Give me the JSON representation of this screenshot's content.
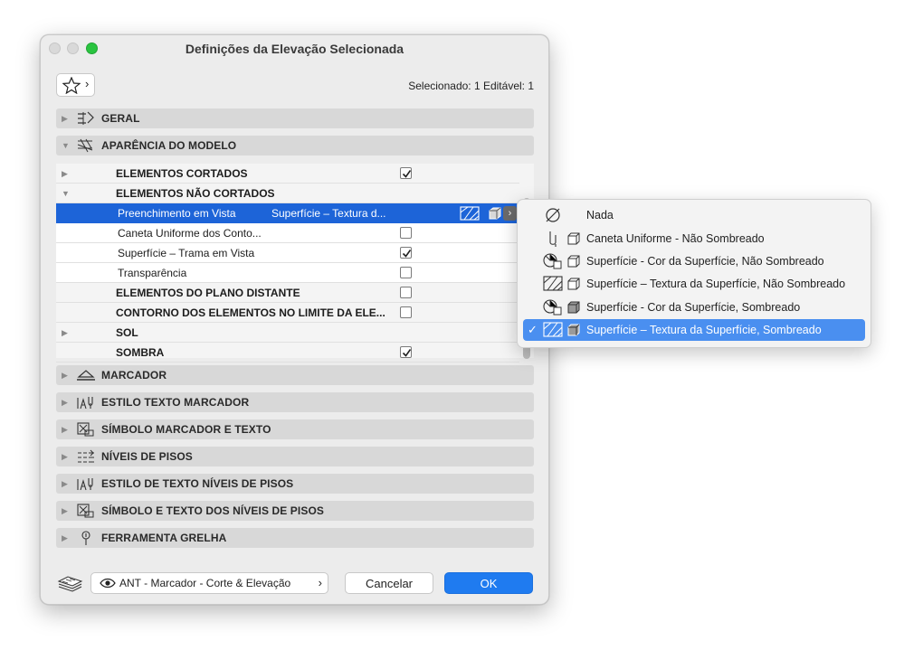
{
  "window": {
    "title": "Definições da Elevação Selecionada",
    "selection_info": "Selecionado: 1 Editável: 1"
  },
  "panels_top": [
    {
      "label": "GERAL",
      "icon": "general-settings-icon",
      "expanded": false
    },
    {
      "label": "APARÊNCIA DO MODELO",
      "icon": "model-appearance-icon",
      "expanded": true
    }
  ],
  "tree": {
    "rows": [
      {
        "label": "ELEMENTOS CORTADOS",
        "bold": true,
        "triangle": "right",
        "checked": true
      },
      {
        "label": "ELEMENTOS NÃO CORTADOS",
        "bold": true,
        "triangle": "down",
        "checked": null
      },
      {
        "label": "Preenchimento em Vista",
        "bold": false,
        "selected": true,
        "value": "Superfície – Textura d..."
      },
      {
        "label": "Caneta Uniforme dos Conto...",
        "bold": false,
        "checked": false
      },
      {
        "label": "Superfície – Trama em Vista",
        "bold": false,
        "checked": true
      },
      {
        "label": "Transparência",
        "bold": false,
        "checked": false
      },
      {
        "label": "ELEMENTOS DO PLANO DISTANTE",
        "bold": true,
        "checked": false
      },
      {
        "label": "CONTORNO DOS ELEMENTOS NO LIMITE DA ELE...",
        "bold": true,
        "checked": false
      },
      {
        "label": "SOL",
        "bold": true,
        "triangle": "right",
        "checked": null
      },
      {
        "label": "SOMBRA",
        "bold": true,
        "checked": true
      }
    ]
  },
  "panels_bottom": [
    {
      "label": "MARCADOR",
      "icon": "marker-icon"
    },
    {
      "label": "ESTILO TEXTO MARCADOR",
      "icon": "marker-text-style-icon"
    },
    {
      "label": "SÍMBOLO MARCADOR E TEXTO",
      "icon": "marker-symbol-icon"
    },
    {
      "label": "NÍVEIS DE PISOS",
      "icon": "story-levels-icon"
    },
    {
      "label": "ESTILO DE TEXTO NÍVEIS DE PISOS",
      "icon": "story-levels-text-style-icon"
    },
    {
      "label": "SÍMBOLO E TEXTO DOS NÍVEIS DE PISOS",
      "icon": "story-levels-symbol-icon"
    },
    {
      "label": "FERRAMENTA GRELHA",
      "icon": "grid-tool-icon"
    }
  ],
  "footer": {
    "favorite": "ANT - Marcador - Corte & Elevação",
    "cancel": "Cancelar",
    "ok": "OK"
  },
  "dropdown": {
    "items": [
      {
        "label": "Nada",
        "icon": "none-icon",
        "checked": false
      },
      {
        "label": "Caneta Uniforme  - Não Sombreado",
        "icon": "uniform-pen-icon",
        "shaded": false,
        "checked": false
      },
      {
        "label": "Superfície - Cor da Superfície, Não Sombreado",
        "icon": "surface-color-icon",
        "shaded": false,
        "checked": false
      },
      {
        "label": "Superfície – Textura da Superfície, Não Sombreado",
        "icon": "surface-texture-icon",
        "shaded": false,
        "checked": false
      },
      {
        "label": "Superfície - Cor da Superfície, Sombreado",
        "icon": "surface-color-icon",
        "shaded": true,
        "checked": false
      },
      {
        "label": "Superfície – Textura da Superfície, Sombreado",
        "icon": "surface-texture-icon",
        "shaded": true,
        "checked": true
      }
    ]
  },
  "colors": {
    "selection": "#1d64d8",
    "ok_button": "#1f7bf0",
    "menu_highlight": "#4a8ff0",
    "close_light": "#2ac440"
  }
}
